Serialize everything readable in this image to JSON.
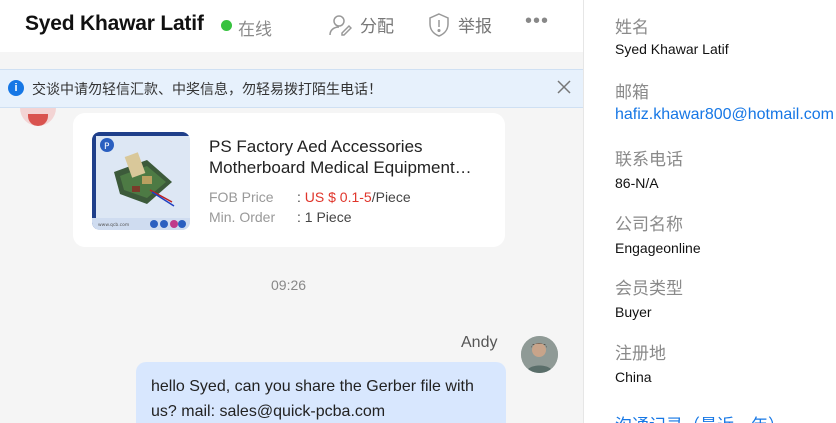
{
  "header": {
    "contact_name": "Syed Khawar Latif",
    "status": "在线",
    "status_color": "#37c23f",
    "assign_label": "分配",
    "report_label": "举报",
    "more_label": "•••"
  },
  "notice": {
    "text": "交谈中请勿轻信汇款、中奖信息，勿轻易拨打陌生电话！",
    "icon": "info-icon"
  },
  "product_card": {
    "title": "PS Factory Aed Accessories",
    "title_line2": "Motherboard Medical Equipment…",
    "price_label": "FOB Price",
    "price_prefix": ": ",
    "price_value": "US $ 0.1-5",
    "price_unit": "/Piece",
    "order_label": "Min. Order",
    "order_value": ": 1 Piece",
    "image_caption": "www.qcb.com"
  },
  "messages": {
    "time": "09:26",
    "sender": "Andy",
    "text": "hello Syed, can you share the Gerber file with us? mail: sales@quick-pcba.com"
  },
  "info_panel": {
    "name_label": "姓名",
    "name_value": "Syed Khawar Latif",
    "email_label": "邮箱",
    "email_value": "hafiz.khawar800@hotmail.com",
    "phone_label": "联系电话",
    "phone_value": "86-N/A",
    "company_label": "公司名称",
    "company_value": "Engageonline",
    "member_label": "会员类型",
    "member_value": "Buyer",
    "region_label": "注册地",
    "region_value": "China",
    "history_link": "沟通记录（最近一年）"
  },
  "colors": {
    "accent": "#1677e5",
    "price": "#e0352b",
    "bubble": "#d8e7fe",
    "notice_bg": "#e7f1fc"
  }
}
